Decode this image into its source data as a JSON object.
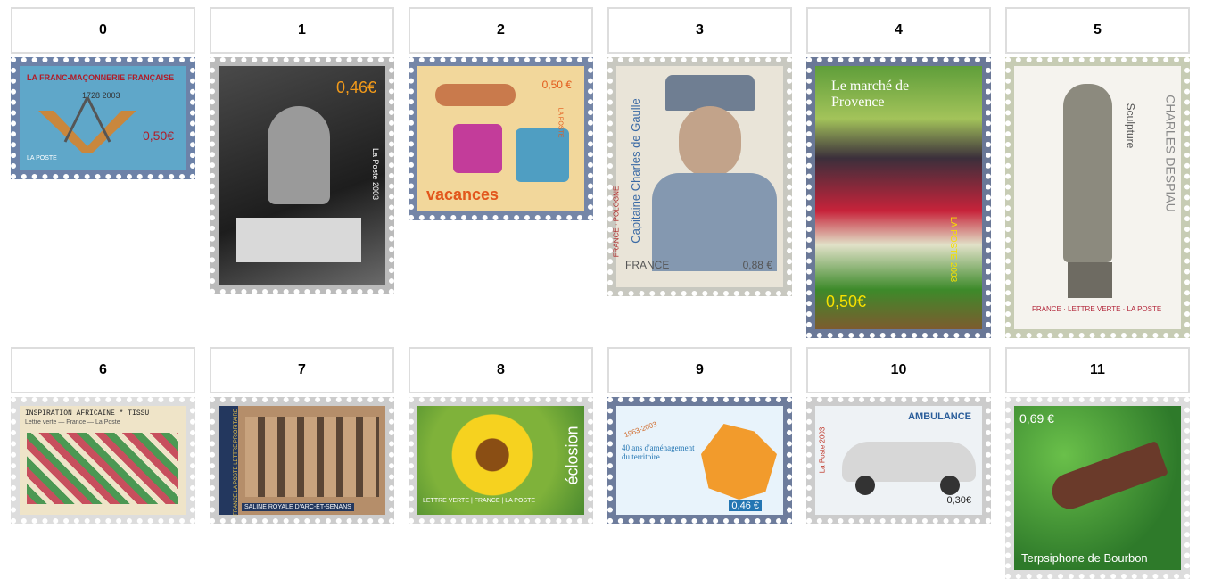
{
  "stamps": [
    {
      "index": "0",
      "title": "LA FRANC-MAÇONNERIE FRANÇAISE",
      "years": "1728 2003",
      "value": "0,50€",
      "corner": "LA POSTE"
    },
    {
      "index": "1",
      "value": "0,46€",
      "corner": "La Poste 2003"
    },
    {
      "index": "2",
      "title": "vacances",
      "value": "0,50 €",
      "corner": "LA POSTE"
    },
    {
      "index": "3",
      "title": "Capitaine Charles de Gaulle",
      "subtitle": "FRANCE · POLOGNE",
      "value": "0,88 €",
      "country": "FRANCE"
    },
    {
      "index": "4",
      "title": "Le marché de Provence",
      "value": "0,50€",
      "corner": "LA POSTE 2003"
    },
    {
      "index": "5",
      "title": "CHARLES DESPIAU",
      "subtitle": "Sculpture",
      "bottom": "FRANCE · LETTRE VERTE · LA POSTE"
    },
    {
      "index": "6",
      "title": "INSPIRATION AFRICAINE * TISSU",
      "subtitle": "Lettre verte — France — La Poste"
    },
    {
      "index": "7",
      "title": "SALINE ROYALE D'ARC-ET-SENANS",
      "subtitle": "FRANCE LA POSTE LETTRE PRIORITAIRE"
    },
    {
      "index": "8",
      "title": "éclosion",
      "subtitle": "LETTRE VERTE | FRANCE | LA POSTE"
    },
    {
      "index": "9",
      "title": "40 ans d'aménagement du territoire",
      "years": "1963-2003",
      "value": "0,46 €"
    },
    {
      "index": "10",
      "title": "AMBULANCE",
      "corner": "La Poste 2003",
      "value": "0,30€"
    },
    {
      "index": "11",
      "title": "Terpsiphone de Bourbon",
      "value": "0,69 €"
    }
  ],
  "colors": {
    "header_border": "#dddddd",
    "stamp_frame_blue": "#6d82a8"
  }
}
